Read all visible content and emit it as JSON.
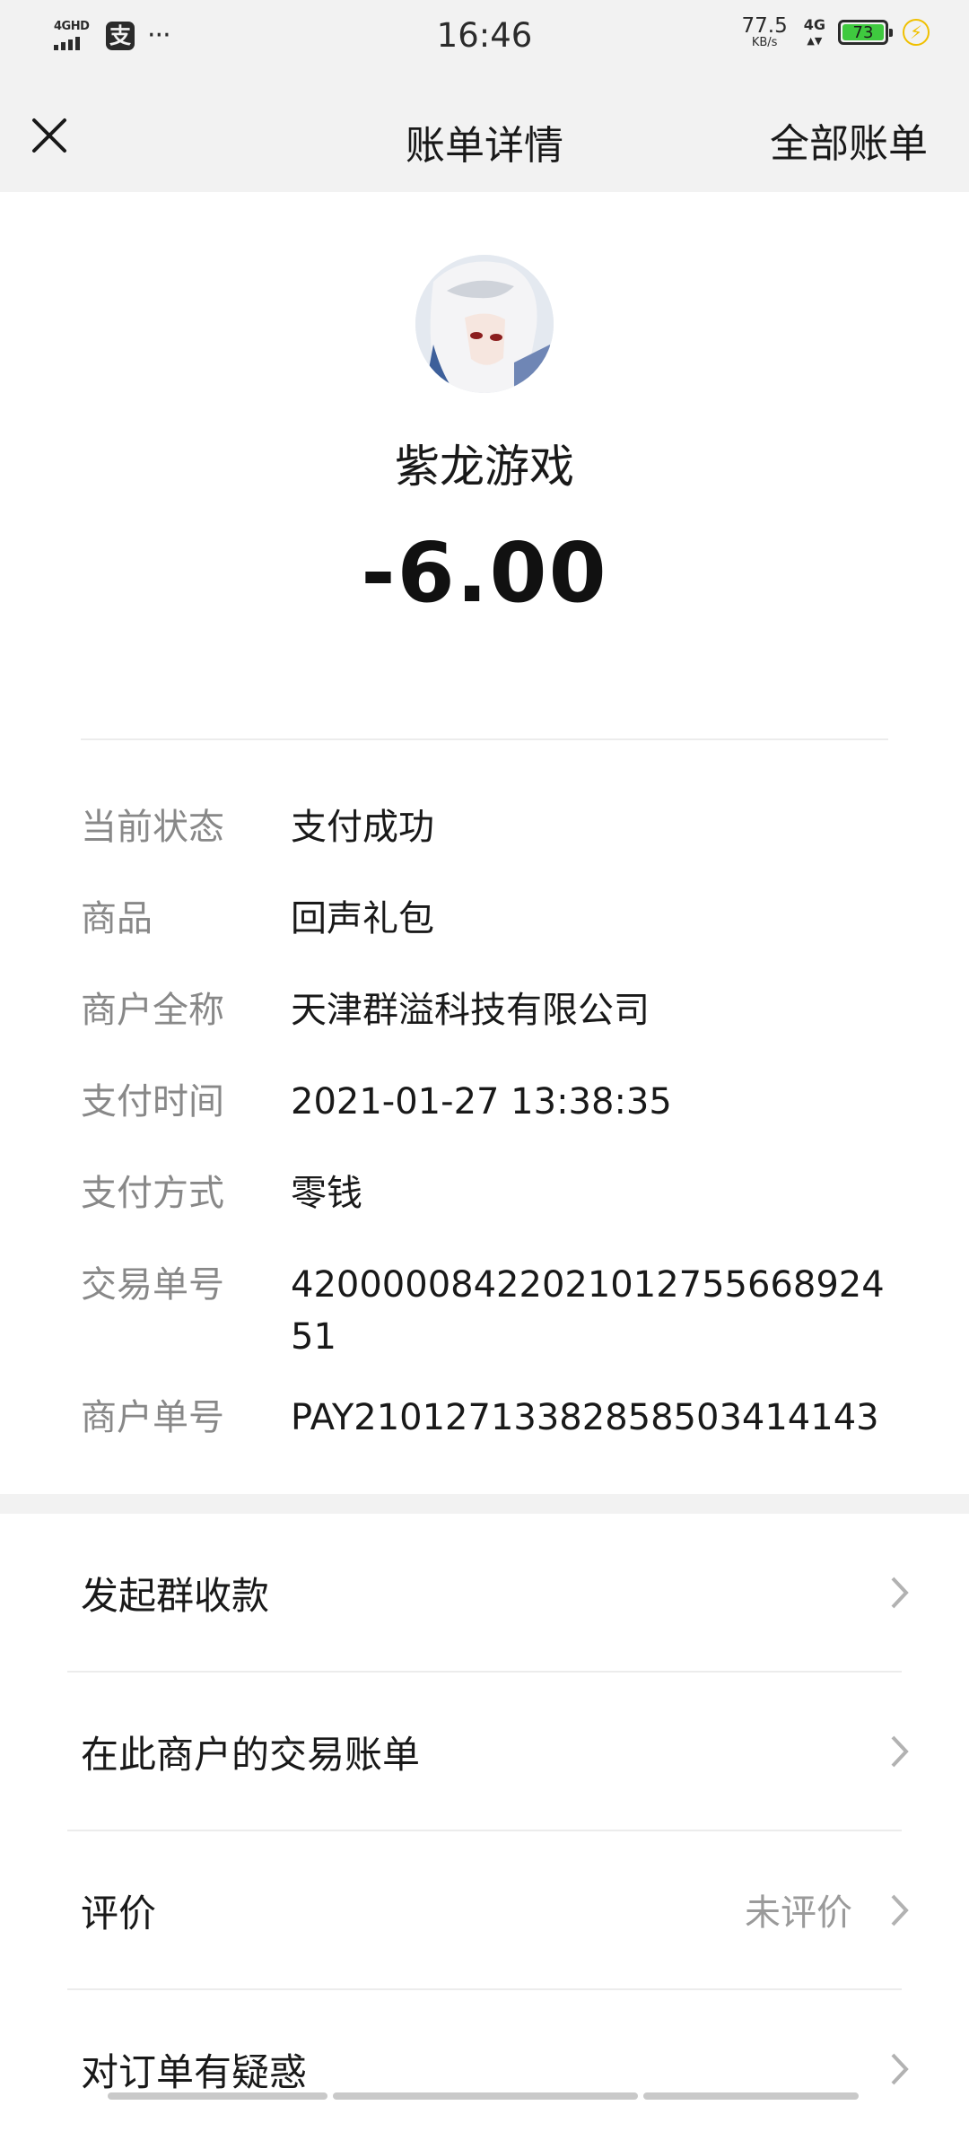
{
  "status_bar": {
    "network_label": "4GHD",
    "app_icon_label": "支",
    "more_label": "···",
    "time": "16:46",
    "speed_value": "77.5",
    "speed_unit": "KB/s",
    "cell_label": "4G",
    "battery_level": "73",
    "charging_icon": "lightning-icon"
  },
  "nav": {
    "title": "账单详情",
    "right_action": "全部账单",
    "close_icon": "close-icon"
  },
  "header": {
    "merchant_name": "紫龙游戏",
    "amount": "-6.00"
  },
  "details": [
    {
      "key": "当前状态",
      "value": "支付成功"
    },
    {
      "key": "商品",
      "value": "回声礼包"
    },
    {
      "key": "商户全称",
      "value": "天津群溢科技有限公司"
    },
    {
      "key": "支付时间",
      "value": "2021-01-27 13:38:35"
    },
    {
      "key": "支付方式",
      "value": "零钱"
    },
    {
      "key": "交易单号",
      "value": "42000008422021012755668924​51"
    },
    {
      "key": "商户单号",
      "value": "PAY21012713382858503414143"
    }
  ],
  "menu": [
    {
      "label": "发起群收款",
      "right": ""
    },
    {
      "label": "在此商户的交易账单",
      "right": ""
    },
    {
      "label": "评价",
      "right": "未评价"
    },
    {
      "label": "对订单有疑惑",
      "right": ""
    }
  ],
  "colors": {
    "bar_bg": "#f2f2f2",
    "secondary_text": "#888888",
    "battery_fill": "#3fc93f",
    "charge_accent": "#f0c000"
  }
}
